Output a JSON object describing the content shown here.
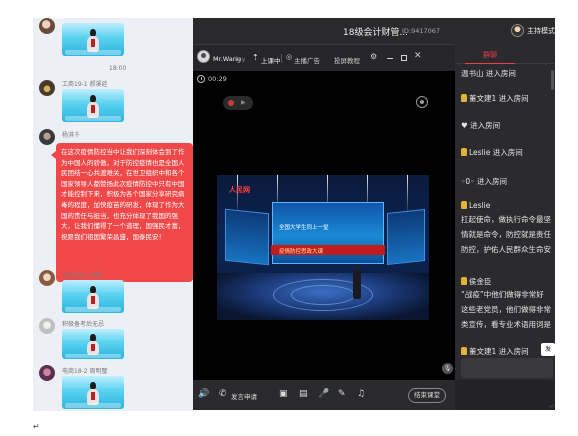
{
  "chat_feed": {
    "timestamp": "18:00",
    "senders": [
      {
        "name": "工商19-1 郝溪廷"
      },
      {
        "name": "杨淇千"
      },
      {
        "name": "工商18-2 冯燕"
      },
      {
        "name": "积极备考后无忌"
      },
      {
        "name": "电商18-2 周明璧"
      }
    ],
    "red_message": "在这次疫情防控当中让我们深刻体会到了作为中国人的骄傲。对于防控疫情也是全国人民团结一心共渡难关，在世卫组织中和各个国家领导人都赞扬此次疫情防控中只有中国才能控制下来，积极为各个国家分享研究病毒的程度，加快疫苗的研发，体现了作为大国的责任与担当，也充分体现了我国的强大，让我们懂得了一个道理，国强民才富，祝愿我们祖国繁荣昌盛，国泰民安！"
  },
  "window": {
    "title": "18级会计财管...",
    "id_label": "ID:9417067",
    "host_mode_label": "主持模式"
  },
  "player": {
    "presenter_name": "Mr.Wang",
    "presenter_name_suffix": "lay",
    "upload_icon": "upload-icon",
    "upload_label": "上课中",
    "ad_label": "主播广告",
    "tutorial_label": "投屏教程",
    "elapsed_time": "00:29",
    "screen_caption_1": "全国大学生同上一堂",
    "screen_caption_2": "疫情防控思政大课",
    "stage_logo": "人民网"
  },
  "toolbar": {
    "request_label": "发言申请",
    "end_class_label": "结束课堂"
  },
  "side_panel": {
    "tab_chat": "群聊",
    "messages": [
      {
        "text": "温书山 进入房间",
        "badge": false
      },
      {
        "text": "董文建1 进入房间",
        "badge": true
      },
      {
        "text": "进入房间",
        "badge": false,
        "prefix": "♥"
      },
      {
        "text": "Leslie 进入房间",
        "badge": true
      },
      {
        "text": "进入房间",
        "badge": false,
        "prefix": "◦0◦"
      },
      {
        "text": "Leslie",
        "badge": true
      }
    ],
    "leslie_lines": [
      "扛起使命，做执行命令最坚",
      "情就是命令，防控就是责任",
      "防控，护佑人民群众生命安"
    ],
    "hou_name": "侯金臣",
    "hou_lines": [
      "“战疫”中他们做得非常好",
      "这些老党员，他们做得非常",
      "类宣传，看专业术语用词是"
    ],
    "last_msg": "董文建1 进入房间",
    "send_label": "发"
  },
  "colors": {
    "accent_red": "#e83f4a",
    "chat_bubble_red": "#f04848",
    "app_bg": "#1d1d1f"
  }
}
